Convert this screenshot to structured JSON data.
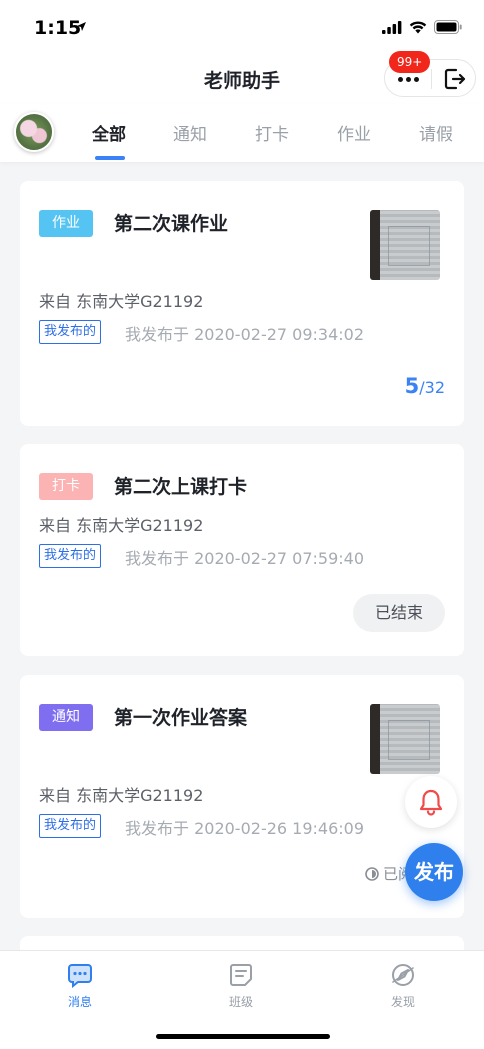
{
  "status_bar": {
    "time": "1:15"
  },
  "header": {
    "title": "老师助手",
    "badge": "99+"
  },
  "tabs": [
    {
      "label": "全部",
      "active": true
    },
    {
      "label": "通知",
      "active": false
    },
    {
      "label": "打卡",
      "active": false
    },
    {
      "label": "作业",
      "active": false
    },
    {
      "label": "请假",
      "active": false
    }
  ],
  "cards": [
    {
      "tag": "作业",
      "tag_color": "#56c4f2",
      "title": "第二次课作业",
      "from": "来自 东南大学G21192",
      "mine": "我发布的",
      "published": "我发布于 2020-02-27 09:34:02",
      "count": "5",
      "total": "/32"
    },
    {
      "tag": "打卡",
      "tag_color": "#fbb3b3",
      "title": "第二次上课打卡",
      "from": "来自 东南大学G21192",
      "mine": "我发布的",
      "published": "我发布于 2020-02-27 07:59:40",
      "status_button": "已结束"
    },
    {
      "tag": "通知",
      "tag_color": "#7f6ff0",
      "title": "第一次作业答案",
      "from": "来自 东南大学G21192",
      "mine": "我发布的",
      "published": "我发布于 2020-02-26 19:46:09",
      "read_status": "已阅"
    }
  ],
  "fab": {
    "publish": "发布"
  },
  "bottom_nav": [
    {
      "label": "消息",
      "icon": "message-icon",
      "active": true
    },
    {
      "label": "班级",
      "icon": "class-icon",
      "active": false
    },
    {
      "label": "发现",
      "icon": "discover-icon",
      "active": false
    }
  ],
  "colors": {
    "accent": "#2f80ed",
    "badge": "#f2271c"
  }
}
